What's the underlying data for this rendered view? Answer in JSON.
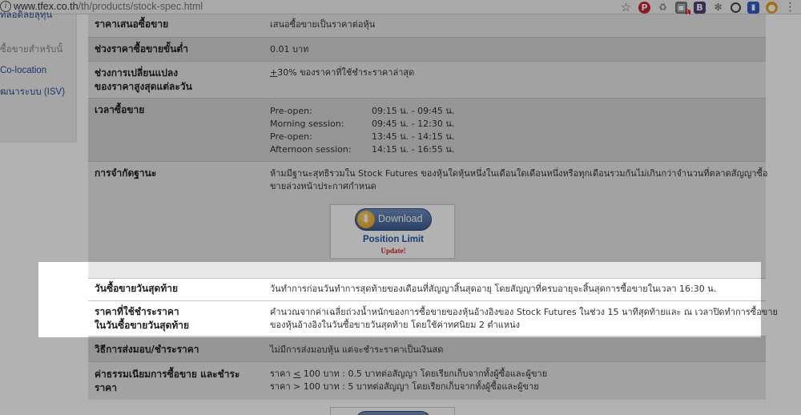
{
  "browser": {
    "url_host": "www.tfex.co.th",
    "url_path": "/th/products/stock-spec.html",
    "info_icon": "info-icon"
  },
  "sidebar": {
    "items": [
      {
        "label": "ทลอดิลยลุทุน"
      },
      {
        "label": "ซื้อขายสำหรับนั้"
      },
      {
        "label": "Co-location"
      },
      {
        "label": "ฒนาระบบ (ISV)"
      }
    ]
  },
  "spec": {
    "price_quote": {
      "label": "ราคาเสนอซื้อขาย",
      "value": "เสนอซื้อขายเป็นราคาต่อหุ้น"
    },
    "tick_size": {
      "label": "ช่วงราคาซื้อขายขั้นต่ำ",
      "value": "0.01 บาท"
    },
    "price_limit": {
      "label_line1": "ช่วงการเปลี่ยนแปลง",
      "label_line2": "ของราคาสูงสุดแต่ละวัน",
      "plus_minus": "+",
      "value": "30% ของราคาที่ใช้ชำระราคาล่าสุด"
    },
    "trading_hours": {
      "label": "เวลาซื้อขาย",
      "sessions": [
        {
          "name": "Pre-open:",
          "time": "09:15 น. - 09:45 น."
        },
        {
          "name": "Morning session:",
          "time": "09:45 น. - 12:30 น."
        },
        {
          "name": "Pre-open:",
          "time": "13:45 น. - 14:15 น."
        },
        {
          "name": "Afternoon session:",
          "time": "14:15 น. - 16:55 น."
        }
      ]
    },
    "position_limit": {
      "label": "การจำกัดฐานะ",
      "value_line1": "ห้ามมีฐานะสุทธิรวมใน Stock Futures ของหุ้นใดหุ้นหนึ่งในเดือนใดเดือนหนึ่งหรือทุกเดือนรวมกันไม่เกินกว่าจำนวนที่ตลาดสัญญาซื้อ",
      "value_line2": "ขายล่วงหน้าประกาศกำหนด"
    },
    "last_trading_day": {
      "label": "วันซื้อขายวันสุดท้าย",
      "value": "วันทำการก่อนวันทำการสุดท้ายของเดือนที่สัญญาสิ้นสุดอายุ โดยสัญญาที่ครบอายุจะสิ้นสุดการซื้อขายในเวลา 16:30 น."
    },
    "final_settlement_price": {
      "label_line1": "ราคาที่ใช้ชำระราคา",
      "label_line2": "ในวันซื้อขายวันสุดท้าย",
      "value_line1": "คำนวณจากค่าเฉลี่ยถ่วงน้ำหนักของการซื้อขายของหุ้นอ้างอิงของ Stock Futures ในช่วง 15 นาทีสุดท้ายและ ณ เวลาปิดทำการซื้อขาย",
      "value_line2": "ของหุ้นอ้างอิงในวันซื้อขายวันสุดท้าย โดยใช้ค่าทศนิยม 2 ตำแหน่ง"
    },
    "settlement_method": {
      "label": "วิธีการส่งมอบ/ชำระราคา",
      "value": "ไม่มีการส่งมอบหุ้น แต่จะชำระราคาเป็นเงินสด"
    },
    "fees": {
      "label_line1": "ค่าธรรมเนียมการซื้อขาย และชำระ",
      "label_line2": "ราคา",
      "value_line1_prefix": "ราคา ",
      "le_sign": "<",
      "value_line1_rest": " 100 บาท : 0.5 บาทต่อสัญญา โดยเรียกเก็บจากทั้งผู้ซื้อและผู้ขาย",
      "value_line2": "ราคา > 100 บาท : 5 บาทต่อสัญญา โดยเรียกเก็บจากทั้งผู้ซื้อและผู้ขาย"
    }
  },
  "download": {
    "button_label": "Download",
    "title": "Position Limit",
    "subtitle": "Update!"
  },
  "colors": {
    "row_dark": "#d6d6d6",
    "row_light": "#e8e8e8",
    "link": "#2a4f9a",
    "download_title": "#1f5aa8",
    "update_red": "#dd2222"
  }
}
